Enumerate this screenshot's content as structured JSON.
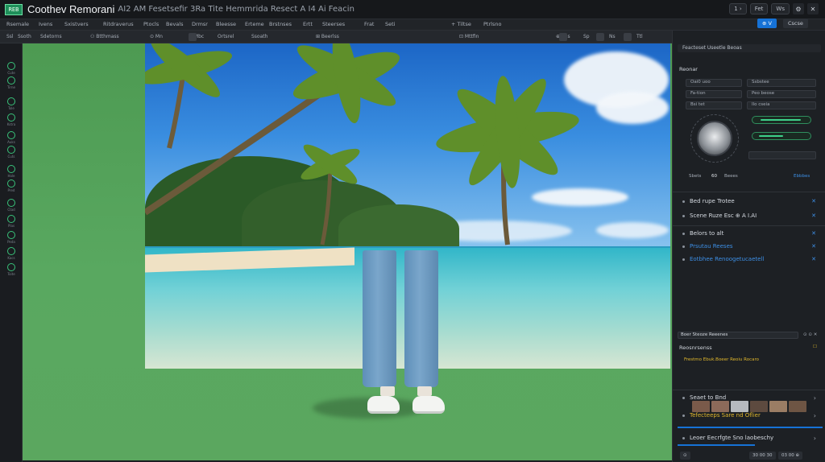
{
  "app": {
    "logo": "REB",
    "title": "Coothev Remorani",
    "subtitle": "AI2 AM Fesetsefir 3Ra Tite Hemmrida Resect A I4 Ai Feacin"
  },
  "titlebar": {
    "chips": [
      "1 ›",
      "Fet",
      "Ws"
    ],
    "icons": [
      "⚙",
      "✕"
    ]
  },
  "menubar": {
    "items": [
      "Rsemale",
      "Ivens",
      "Sxistvers",
      "Ritdraverus",
      "Ptocls",
      "Bevals",
      "Drmsr",
      "Bleesse",
      "Erteme",
      "Brstnses",
      "Ertt",
      "Steerses",
      "Frat",
      "Seti",
      "+ Tiltse",
      "Ptrlsno"
    ],
    "primary_btn": "⊕ V",
    "secondary_btn": "Cscse"
  },
  "optbar": {
    "items": [
      "Ssl",
      "Ssoth",
      "Sdetorns",
      "⚇ Btthmass",
      "⊙ Mn",
      "⊙ Mbc",
      "Ortsrel",
      "Ssoath",
      "⊞ Beerlss",
      "⊡ Mttfin",
      "⊕ Shs",
      "Sp",
      "Ns",
      "Ttl"
    ]
  },
  "rail": {
    "labels": [
      "Cute",
      "Tirne",
      "Tole",
      "Kstra",
      "Auks",
      "Cuts",
      "Hole",
      "Pred",
      "Ctad",
      "Plas",
      "Peda",
      "Kacs",
      "Toite",
      "Sarr",
      "Bens"
    ]
  },
  "panel": {
    "header": "Feacteset Useetle Beoas",
    "section_title": "Reonar",
    "fields_left": [
      "Oai0 uoo",
      "Fa-tion",
      "Bsi tet"
    ],
    "fields_right": [
      "Ssbstee",
      "Peo beose",
      "Ilo cseia"
    ],
    "knob_values": [
      "Sbets",
      "60",
      "Beees"
    ],
    "slider_label": "Ebbbes",
    "list_a": [
      {
        "label": "Bed rupe Trotee",
        "blue": false
      },
      {
        "label": "Scene Ruze Esc  ⊕ A I.AI",
        "blue": false
      }
    ],
    "list_b": [
      {
        "label": "Belors to alt",
        "blue": false
      },
      {
        "label": "Prsutau Reeses",
        "blue": true
      },
      {
        "label": "Eotbhee Renoogetucaetell",
        "blue": true
      }
    ],
    "search_label": "Boer Steoze Reeenes",
    "recent_title": "Reosnrsenss",
    "recent_item": "Frestmo Ebuk.Boeer Reoiu Rocaro",
    "more_rows": [
      "Seaet to Bnd",
      "Tefecteeps Sare nd Oflier"
    ],
    "bottom_row": "Leoer Eecrfgte Sno laobeschy",
    "bottom_btns": [
      "30 00 30",
      "03 00 ⊕"
    ]
  },
  "colors": {
    "accent": "#1672d6",
    "green": "#39c27a",
    "canvas_green": "#59a860"
  }
}
